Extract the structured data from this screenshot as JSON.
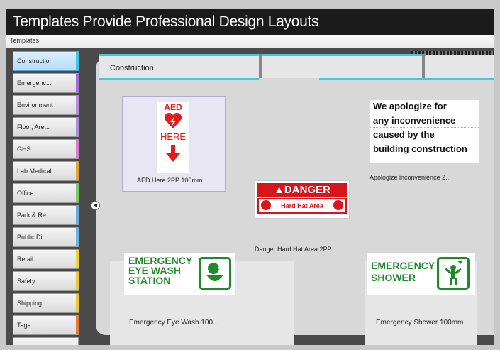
{
  "banner": {
    "title": "Templates Provide Professional Design Layouts"
  },
  "window": {
    "title": "Templates"
  },
  "categories": [
    {
      "label": "Construction",
      "color": "#3fc6e6",
      "selected": true
    },
    {
      "label": "Emergenc...",
      "color": "#9b6fd6"
    },
    {
      "label": "Environment",
      "color": "#b48be0"
    },
    {
      "label": "Floor, Are...",
      "color": "#a68fd8"
    },
    {
      "label": "GHS",
      "color": "#d87ad2"
    },
    {
      "label": "Lab Medical",
      "color": "#e6a23a"
    },
    {
      "label": "Office",
      "color": "#7ac76a"
    },
    {
      "label": "Park & Re...",
      "color": "#6aaad8"
    },
    {
      "label": "Public Dir...",
      "color": "#6ab2e6"
    },
    {
      "label": "Retail",
      "color": "#e6d23a"
    },
    {
      "label": "Safety",
      "color": "#e6c83a"
    },
    {
      "label": "Shipping",
      "color": "#e6c83a"
    },
    {
      "label": "Tags",
      "color": "#e6782e"
    }
  ],
  "tab": {
    "label": "Construction"
  },
  "templates": {
    "aed": {
      "caption": "AED Here 2PP 100mm",
      "line1": "AED",
      "line2": "HERE"
    },
    "danger": {
      "caption": "Danger Hard Hat Area 2PP...",
      "header": "DANGER",
      "sub": "Hard Hat Area"
    },
    "apologize": {
      "caption": "Apologize inconvenience 2...",
      "lines": [
        "We apologize for",
        "any inconvenience",
        "caused by the",
        "building construction"
      ]
    },
    "eyewash": {
      "caption": "Emergency Eye Wash 100...",
      "lines": [
        "EMERGENCY",
        "EYE WASH",
        "STATION"
      ]
    },
    "shower": {
      "caption": "Emergency Shower 100mm",
      "lines": [
        "EMERGENCY",
        "SHOWER"
      ]
    }
  },
  "colors": {
    "accent": "#3fc6e6",
    "danger_red": "#d9151b",
    "safety_green": "#1f8a2a"
  }
}
